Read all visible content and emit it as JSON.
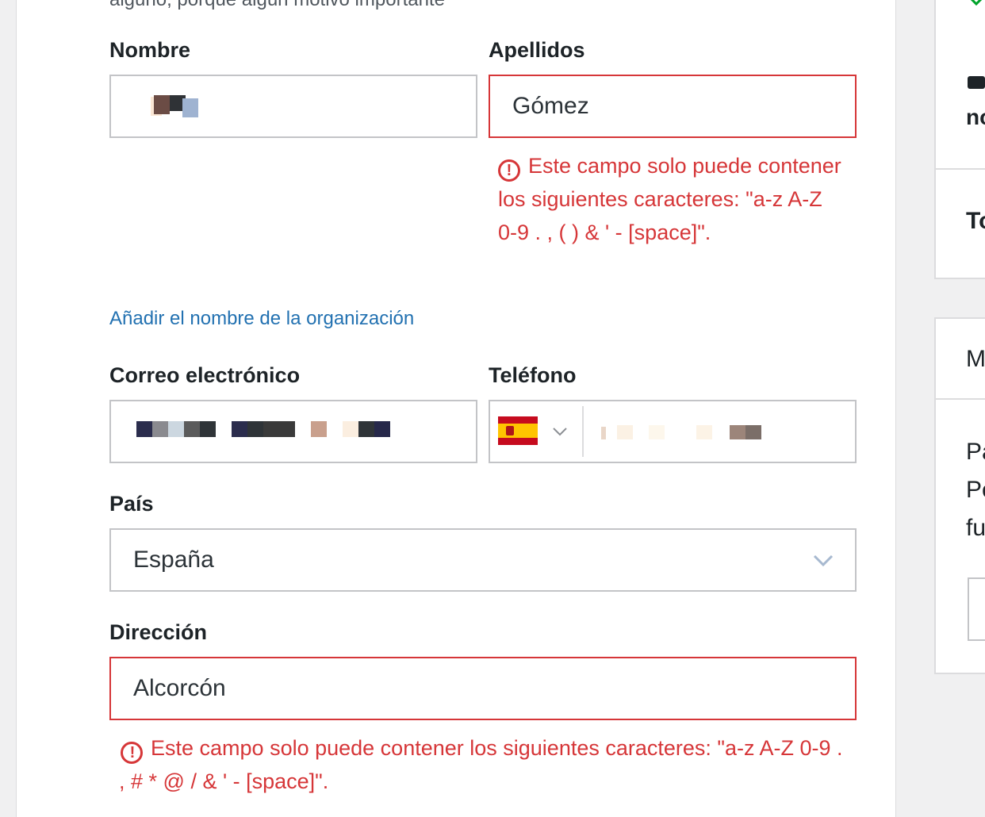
{
  "form": {
    "intro_text_cut": "alguno, porque algún motivo importante",
    "first_name": {
      "label": "Nombre",
      "value": "Clara"
    },
    "last_name": {
      "label": "Apellidos",
      "value": "Gómez",
      "error": "Este campo solo puede contener los siguientes caracteres: \"a-z A-Z 0-9 . , ( ) & ' - [space]\"."
    },
    "add_org_link": "Añadir el nombre de la organización",
    "email": {
      "label": "Correo electrónico",
      "value": "clara.gom@gmail.com"
    },
    "phone": {
      "label": "Teléfono",
      "country_flag": "spain-flag-icon"
    },
    "country": {
      "label": "País",
      "selected": "España"
    },
    "address": {
      "label": "Dirección",
      "value": "Alcorcón",
      "error": "Este campo solo puede contener los siguientes caracteres: \"a-z A-Z 0-9 . , # * @ / & ' - [space]\"."
    }
  },
  "right_col": {
    "t1": "no",
    "t2": "To",
    "t3": "M",
    "t4": "Pa",
    "t5": "Pc",
    "t6": "fu"
  },
  "colors": {
    "error": "#d63638",
    "link": "#2271b1",
    "border": "#c3c4c7",
    "check": "#00a32a"
  }
}
